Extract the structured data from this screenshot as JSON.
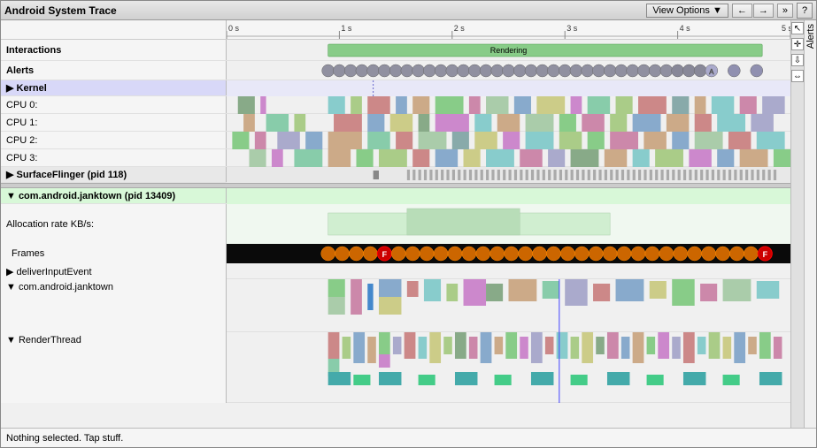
{
  "title": "Android System Trace",
  "toolbar": {
    "view_options": "View Options ▼",
    "nav_back": "←",
    "nav_forward": "→",
    "expand": "»",
    "help": "?"
  },
  "timeline": {
    "markers": [
      "0 s",
      "1 s",
      "2 s",
      "3 s",
      "4 s",
      "5 s"
    ]
  },
  "sections": {
    "interactions": "Interactions",
    "alerts": "Alerts",
    "kernel": "▶ Kernel",
    "cpu0": "CPU 0:",
    "cpu1": "CPU 1:",
    "cpu2": "CPU 2:",
    "cpu3": "CPU 3:",
    "surfaceflinger": "▶ SurfaceFlinger (pid 118)",
    "janktown": "▼ com.android.janktown (pid 13409)",
    "allocation_rate": "Allocation rate KB/s:",
    "frames": "Frames",
    "deliver_input": "▶ deliverInputEvent",
    "janktown_thread": "▼ com.android.janktown",
    "render_thread": "▼ RenderThread"
  },
  "status": "Nothing selected. Tap stuff.",
  "alerts_sidebar": "Alerts",
  "colors": {
    "rendering_bar": "#88cc88",
    "kernel_header": "#d0d0ff",
    "janktown_header": "#d0ffd0",
    "selection_cursor": "#4444ff"
  }
}
